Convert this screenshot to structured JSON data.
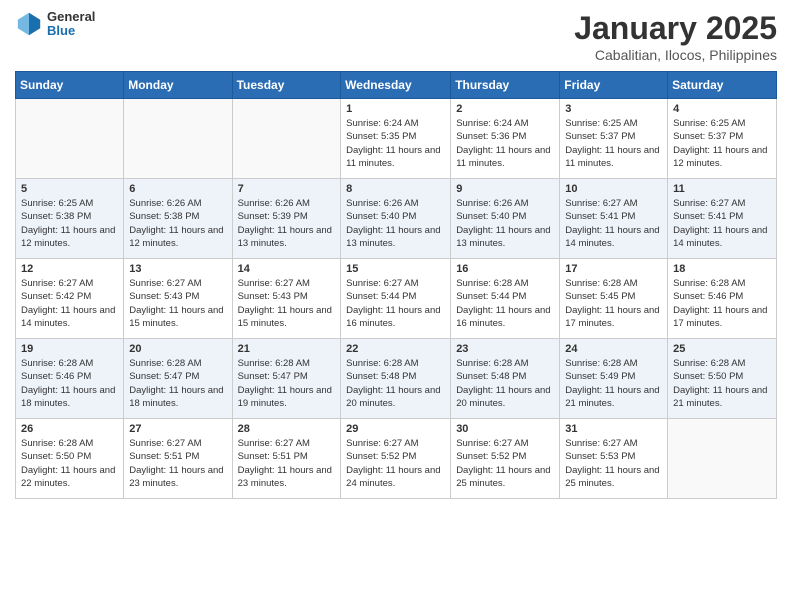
{
  "header": {
    "logo_general": "General",
    "logo_blue": "Blue",
    "month_title": "January 2025",
    "location": "Cabalitian, Ilocos, Philippines"
  },
  "weekdays": [
    "Sunday",
    "Monday",
    "Tuesday",
    "Wednesday",
    "Thursday",
    "Friday",
    "Saturday"
  ],
  "weeks": [
    [
      {
        "day": "",
        "info": ""
      },
      {
        "day": "",
        "info": ""
      },
      {
        "day": "",
        "info": ""
      },
      {
        "day": "1",
        "info": "Sunrise: 6:24 AM\nSunset: 5:35 PM\nDaylight: 11 hours and 11 minutes."
      },
      {
        "day": "2",
        "info": "Sunrise: 6:24 AM\nSunset: 5:36 PM\nDaylight: 11 hours and 11 minutes."
      },
      {
        "day": "3",
        "info": "Sunrise: 6:25 AM\nSunset: 5:37 PM\nDaylight: 11 hours and 11 minutes."
      },
      {
        "day": "4",
        "info": "Sunrise: 6:25 AM\nSunset: 5:37 PM\nDaylight: 11 hours and 12 minutes."
      }
    ],
    [
      {
        "day": "5",
        "info": "Sunrise: 6:25 AM\nSunset: 5:38 PM\nDaylight: 11 hours and 12 minutes."
      },
      {
        "day": "6",
        "info": "Sunrise: 6:26 AM\nSunset: 5:38 PM\nDaylight: 11 hours and 12 minutes."
      },
      {
        "day": "7",
        "info": "Sunrise: 6:26 AM\nSunset: 5:39 PM\nDaylight: 11 hours and 13 minutes."
      },
      {
        "day": "8",
        "info": "Sunrise: 6:26 AM\nSunset: 5:40 PM\nDaylight: 11 hours and 13 minutes."
      },
      {
        "day": "9",
        "info": "Sunrise: 6:26 AM\nSunset: 5:40 PM\nDaylight: 11 hours and 13 minutes."
      },
      {
        "day": "10",
        "info": "Sunrise: 6:27 AM\nSunset: 5:41 PM\nDaylight: 11 hours and 14 minutes."
      },
      {
        "day": "11",
        "info": "Sunrise: 6:27 AM\nSunset: 5:41 PM\nDaylight: 11 hours and 14 minutes."
      }
    ],
    [
      {
        "day": "12",
        "info": "Sunrise: 6:27 AM\nSunset: 5:42 PM\nDaylight: 11 hours and 14 minutes."
      },
      {
        "day": "13",
        "info": "Sunrise: 6:27 AM\nSunset: 5:43 PM\nDaylight: 11 hours and 15 minutes."
      },
      {
        "day": "14",
        "info": "Sunrise: 6:27 AM\nSunset: 5:43 PM\nDaylight: 11 hours and 15 minutes."
      },
      {
        "day": "15",
        "info": "Sunrise: 6:27 AM\nSunset: 5:44 PM\nDaylight: 11 hours and 16 minutes."
      },
      {
        "day": "16",
        "info": "Sunrise: 6:28 AM\nSunset: 5:44 PM\nDaylight: 11 hours and 16 minutes."
      },
      {
        "day": "17",
        "info": "Sunrise: 6:28 AM\nSunset: 5:45 PM\nDaylight: 11 hours and 17 minutes."
      },
      {
        "day": "18",
        "info": "Sunrise: 6:28 AM\nSunset: 5:46 PM\nDaylight: 11 hours and 17 minutes."
      }
    ],
    [
      {
        "day": "19",
        "info": "Sunrise: 6:28 AM\nSunset: 5:46 PM\nDaylight: 11 hours and 18 minutes."
      },
      {
        "day": "20",
        "info": "Sunrise: 6:28 AM\nSunset: 5:47 PM\nDaylight: 11 hours and 18 minutes."
      },
      {
        "day": "21",
        "info": "Sunrise: 6:28 AM\nSunset: 5:47 PM\nDaylight: 11 hours and 19 minutes."
      },
      {
        "day": "22",
        "info": "Sunrise: 6:28 AM\nSunset: 5:48 PM\nDaylight: 11 hours and 20 minutes."
      },
      {
        "day": "23",
        "info": "Sunrise: 6:28 AM\nSunset: 5:48 PM\nDaylight: 11 hours and 20 minutes."
      },
      {
        "day": "24",
        "info": "Sunrise: 6:28 AM\nSunset: 5:49 PM\nDaylight: 11 hours and 21 minutes."
      },
      {
        "day": "25",
        "info": "Sunrise: 6:28 AM\nSunset: 5:50 PM\nDaylight: 11 hours and 21 minutes."
      }
    ],
    [
      {
        "day": "26",
        "info": "Sunrise: 6:28 AM\nSunset: 5:50 PM\nDaylight: 11 hours and 22 minutes."
      },
      {
        "day": "27",
        "info": "Sunrise: 6:27 AM\nSunset: 5:51 PM\nDaylight: 11 hours and 23 minutes."
      },
      {
        "day": "28",
        "info": "Sunrise: 6:27 AM\nSunset: 5:51 PM\nDaylight: 11 hours and 23 minutes."
      },
      {
        "day": "29",
        "info": "Sunrise: 6:27 AM\nSunset: 5:52 PM\nDaylight: 11 hours and 24 minutes."
      },
      {
        "day": "30",
        "info": "Sunrise: 6:27 AM\nSunset: 5:52 PM\nDaylight: 11 hours and 25 minutes."
      },
      {
        "day": "31",
        "info": "Sunrise: 6:27 AM\nSunset: 5:53 PM\nDaylight: 11 hours and 25 minutes."
      },
      {
        "day": "",
        "info": ""
      }
    ]
  ]
}
